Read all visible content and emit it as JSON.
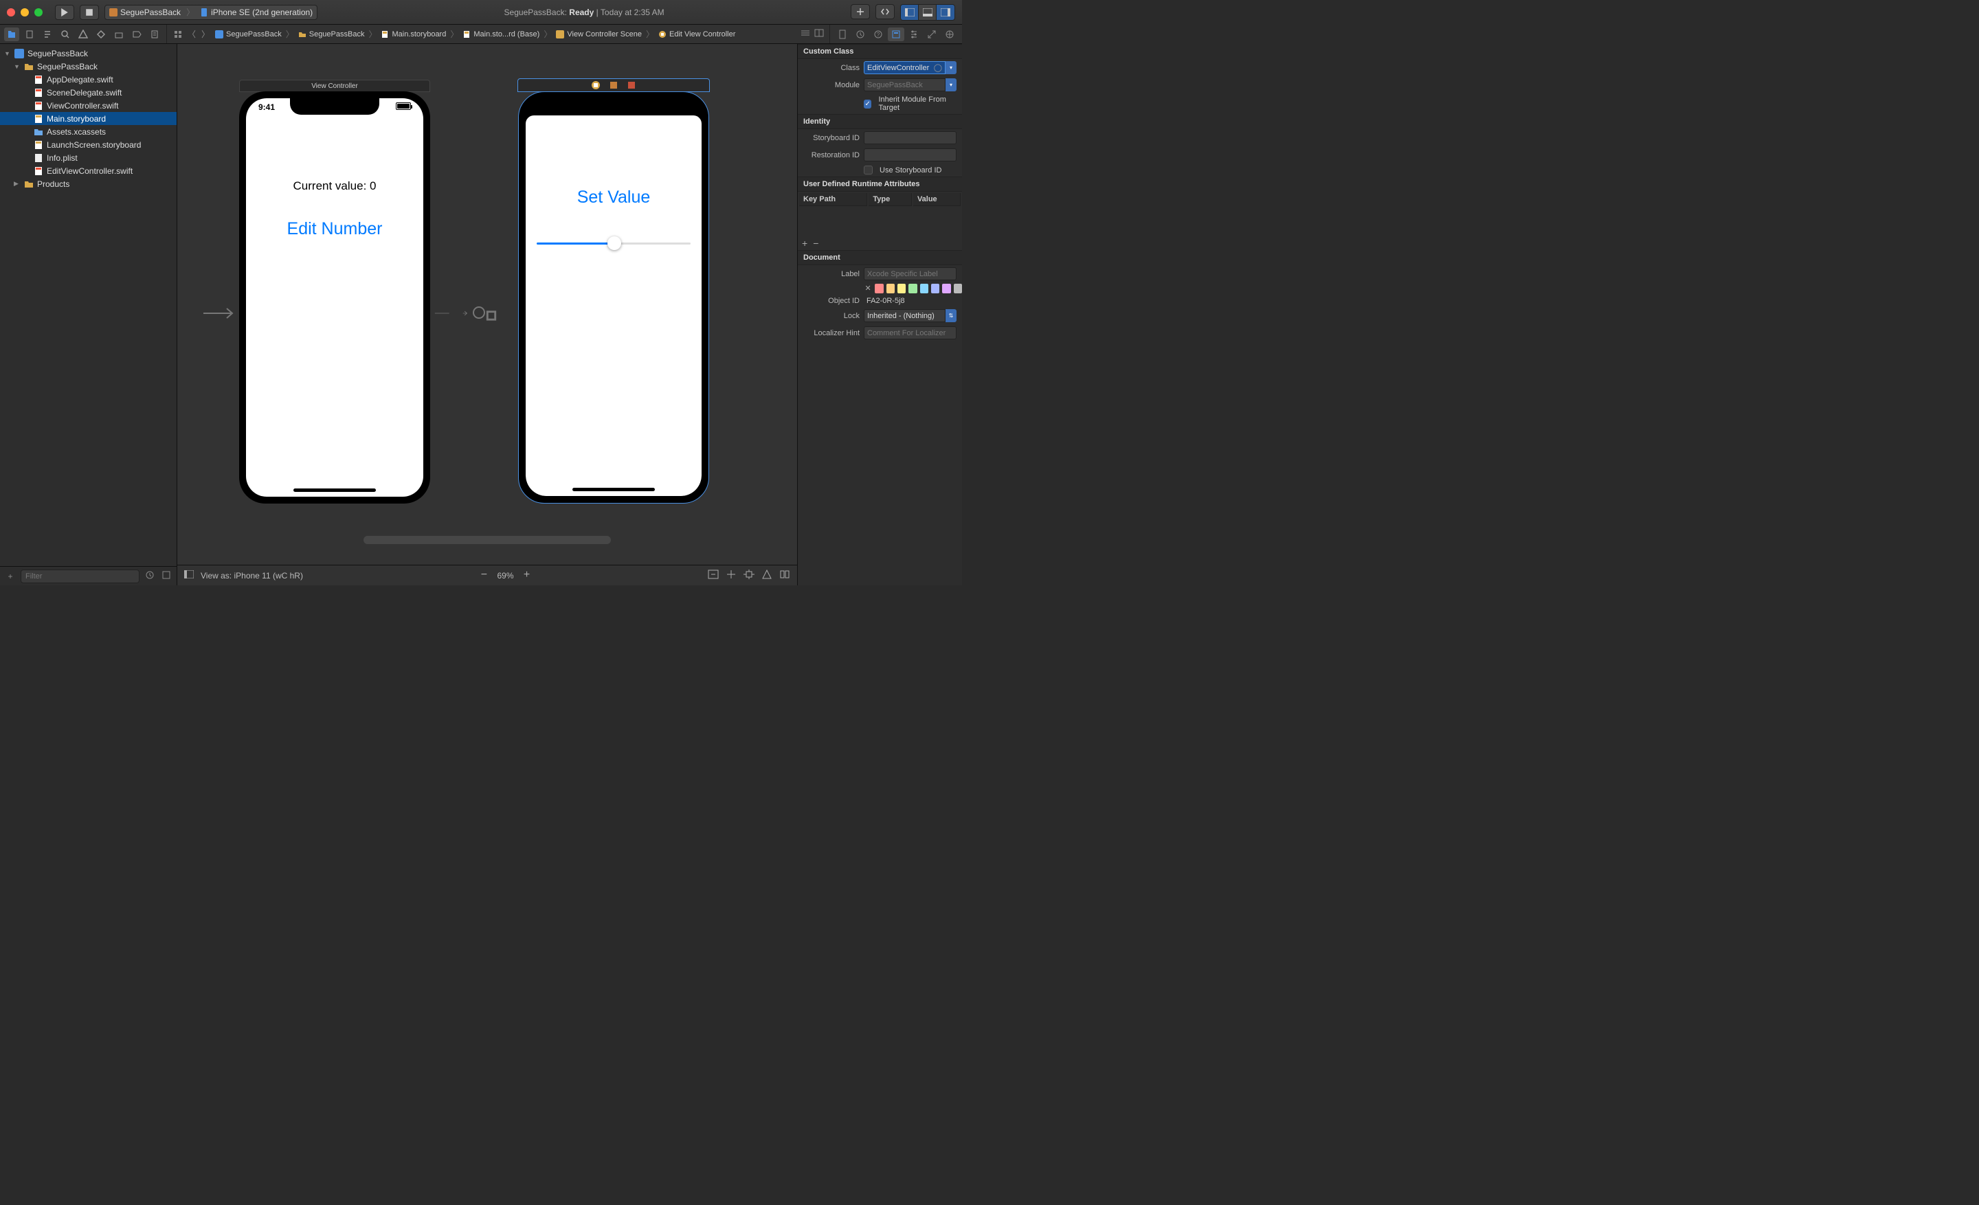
{
  "scheme": {
    "project": "SeguePassBack",
    "device": "iPhone SE (2nd generation)"
  },
  "status": {
    "project": "SeguePassBack",
    "state": "Ready",
    "time": "Today at 2:35 AM"
  },
  "navigator": {
    "root": "SeguePassBack",
    "group": "SeguePassBack",
    "files": [
      "AppDelegate.swift",
      "SceneDelegate.swift",
      "ViewController.swift",
      "Main.storyboard",
      "Assets.xcassets",
      "LaunchScreen.storyboard",
      "Info.plist",
      "EditViewController.swift"
    ],
    "selected_index": 3,
    "products": "Products",
    "filter_placeholder": "Filter"
  },
  "breadcrumb": [
    "SeguePassBack",
    "SeguePassBack",
    "Main.storyboard",
    "Main.sto...rd (Base)",
    "View Controller Scene",
    "Edit View Controller"
  ],
  "canvas": {
    "vc1": {
      "title": "View Controller",
      "time": "9:41",
      "label1": "Current value: 0",
      "button1": "Edit Number"
    },
    "vc2": {
      "button1": "Set Value"
    }
  },
  "bottom": {
    "view_as": "View as: iPhone 11 (wC hR)",
    "zoom": "69%"
  },
  "inspector": {
    "custom_class_h": "Custom Class",
    "class_l": "Class",
    "class_v": "EditViewController",
    "module_l": "Module",
    "module_ph": "SeguePassBack",
    "inherit_l": "Inherit Module From Target",
    "identity_h": "Identity",
    "sbid_l": "Storyboard ID",
    "restid_l": "Restoration ID",
    "use_sbid_l": "Use Storyboard ID",
    "rta_h": "User Defined Runtime Attributes",
    "rta_cols": {
      "kp": "Key Path",
      "ty": "Type",
      "va": "Value"
    },
    "doc_h": "Document",
    "label_l": "Label",
    "label_ph": "Xcode Specific Label",
    "objid_l": "Object ID",
    "objid_v": "FA2-0R-5j8",
    "lock_l": "Lock",
    "lock_v": "Inherited - (Nothing)",
    "hint_l": "Localizer Hint",
    "hint_ph": "Comment For Localizer",
    "swatches": [
      "#ff8a8a",
      "#ffd080",
      "#ffef8a",
      "#9fe89f",
      "#8ad7ff",
      "#a8b8ff",
      "#e0a8ff",
      "#bbb"
    ]
  }
}
